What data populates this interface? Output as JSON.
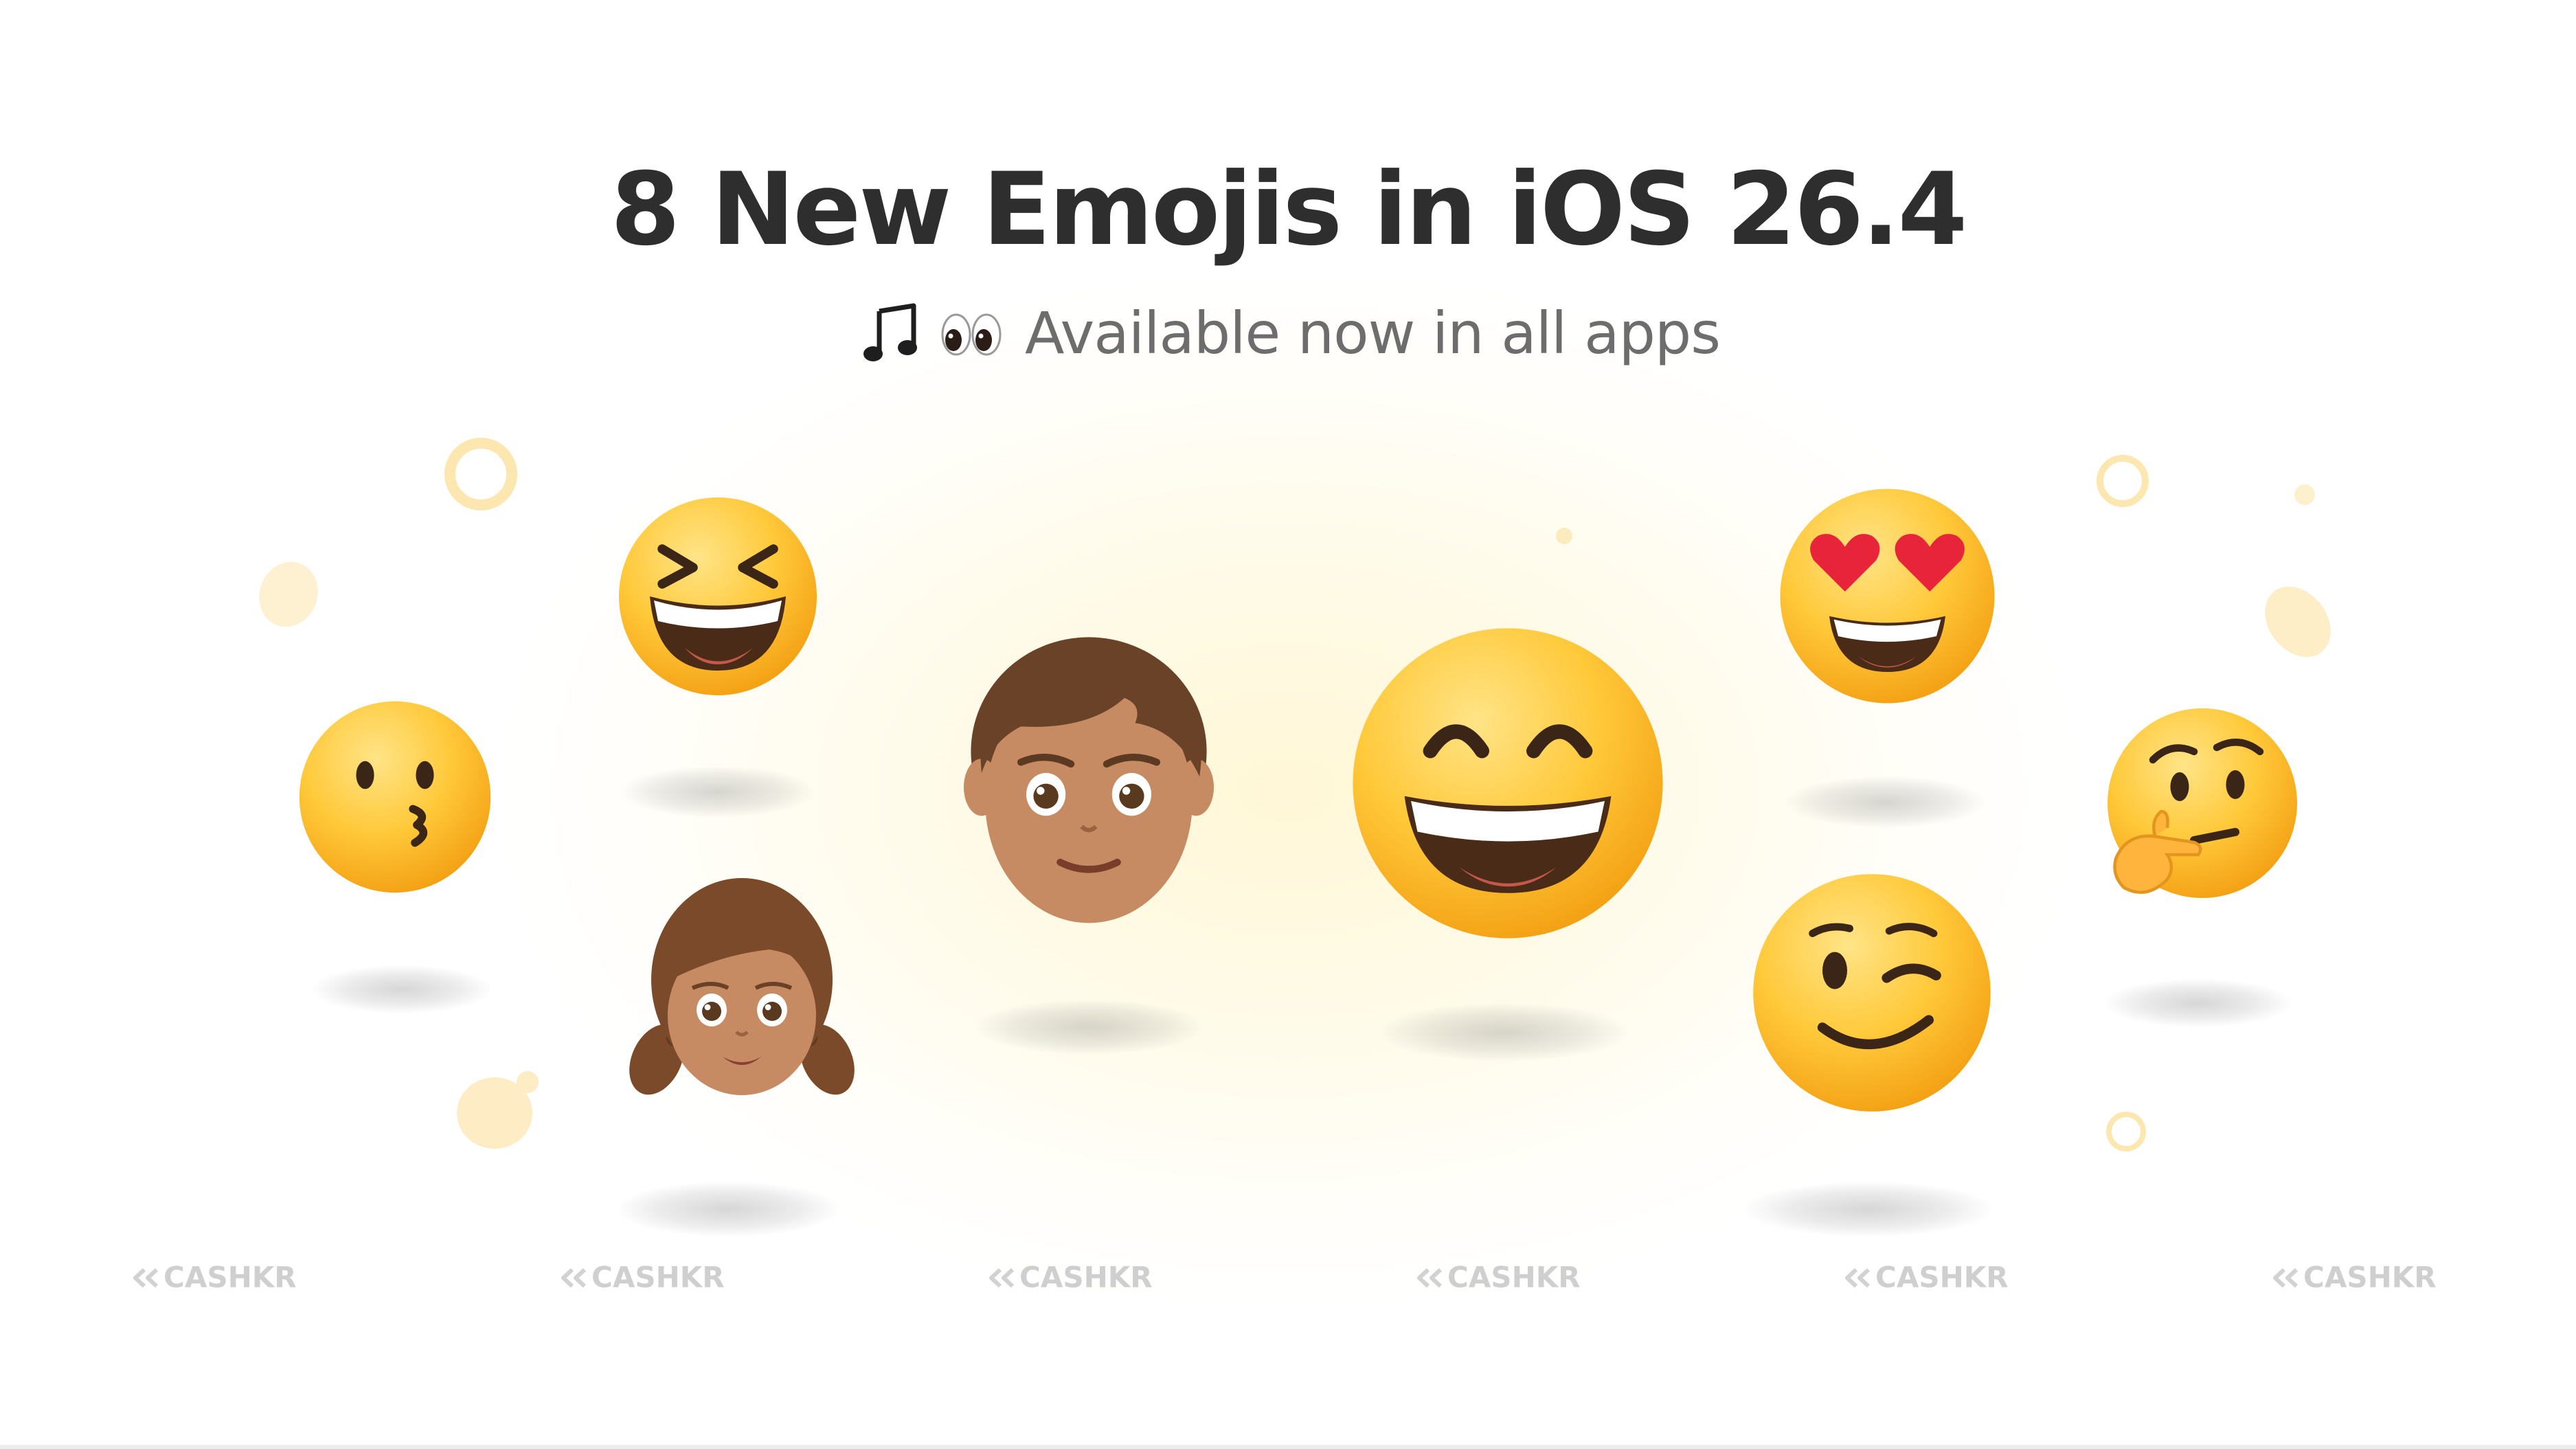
{
  "heading": {
    "title": "8 New Emojis in iOS 26.4",
    "subtitle": "Available now in all apps",
    "subtitle_icons": [
      "musical-note-icon",
      "eyes-icon"
    ]
  },
  "emojis": [
    {
      "name": "kissing-face-emoji"
    },
    {
      "name": "grinning-squinting-face-emoji"
    },
    {
      "name": "girl-emoji"
    },
    {
      "name": "boy-emoji"
    },
    {
      "name": "grinning-face-smiling-eyes-emoji"
    },
    {
      "name": "heart-eyes-emoji"
    },
    {
      "name": "winking-face-emoji"
    },
    {
      "name": "thinking-face-emoji"
    }
  ],
  "watermark": {
    "text": "CASHKR",
    "count": 6,
    "icon": "double-chevron-left-icon"
  },
  "colors": {
    "title": "#2e2e2e",
    "subtitle": "#6d6d6d",
    "emoji_yellow": "#ffc93a",
    "watermark": "#cfcfcf"
  }
}
